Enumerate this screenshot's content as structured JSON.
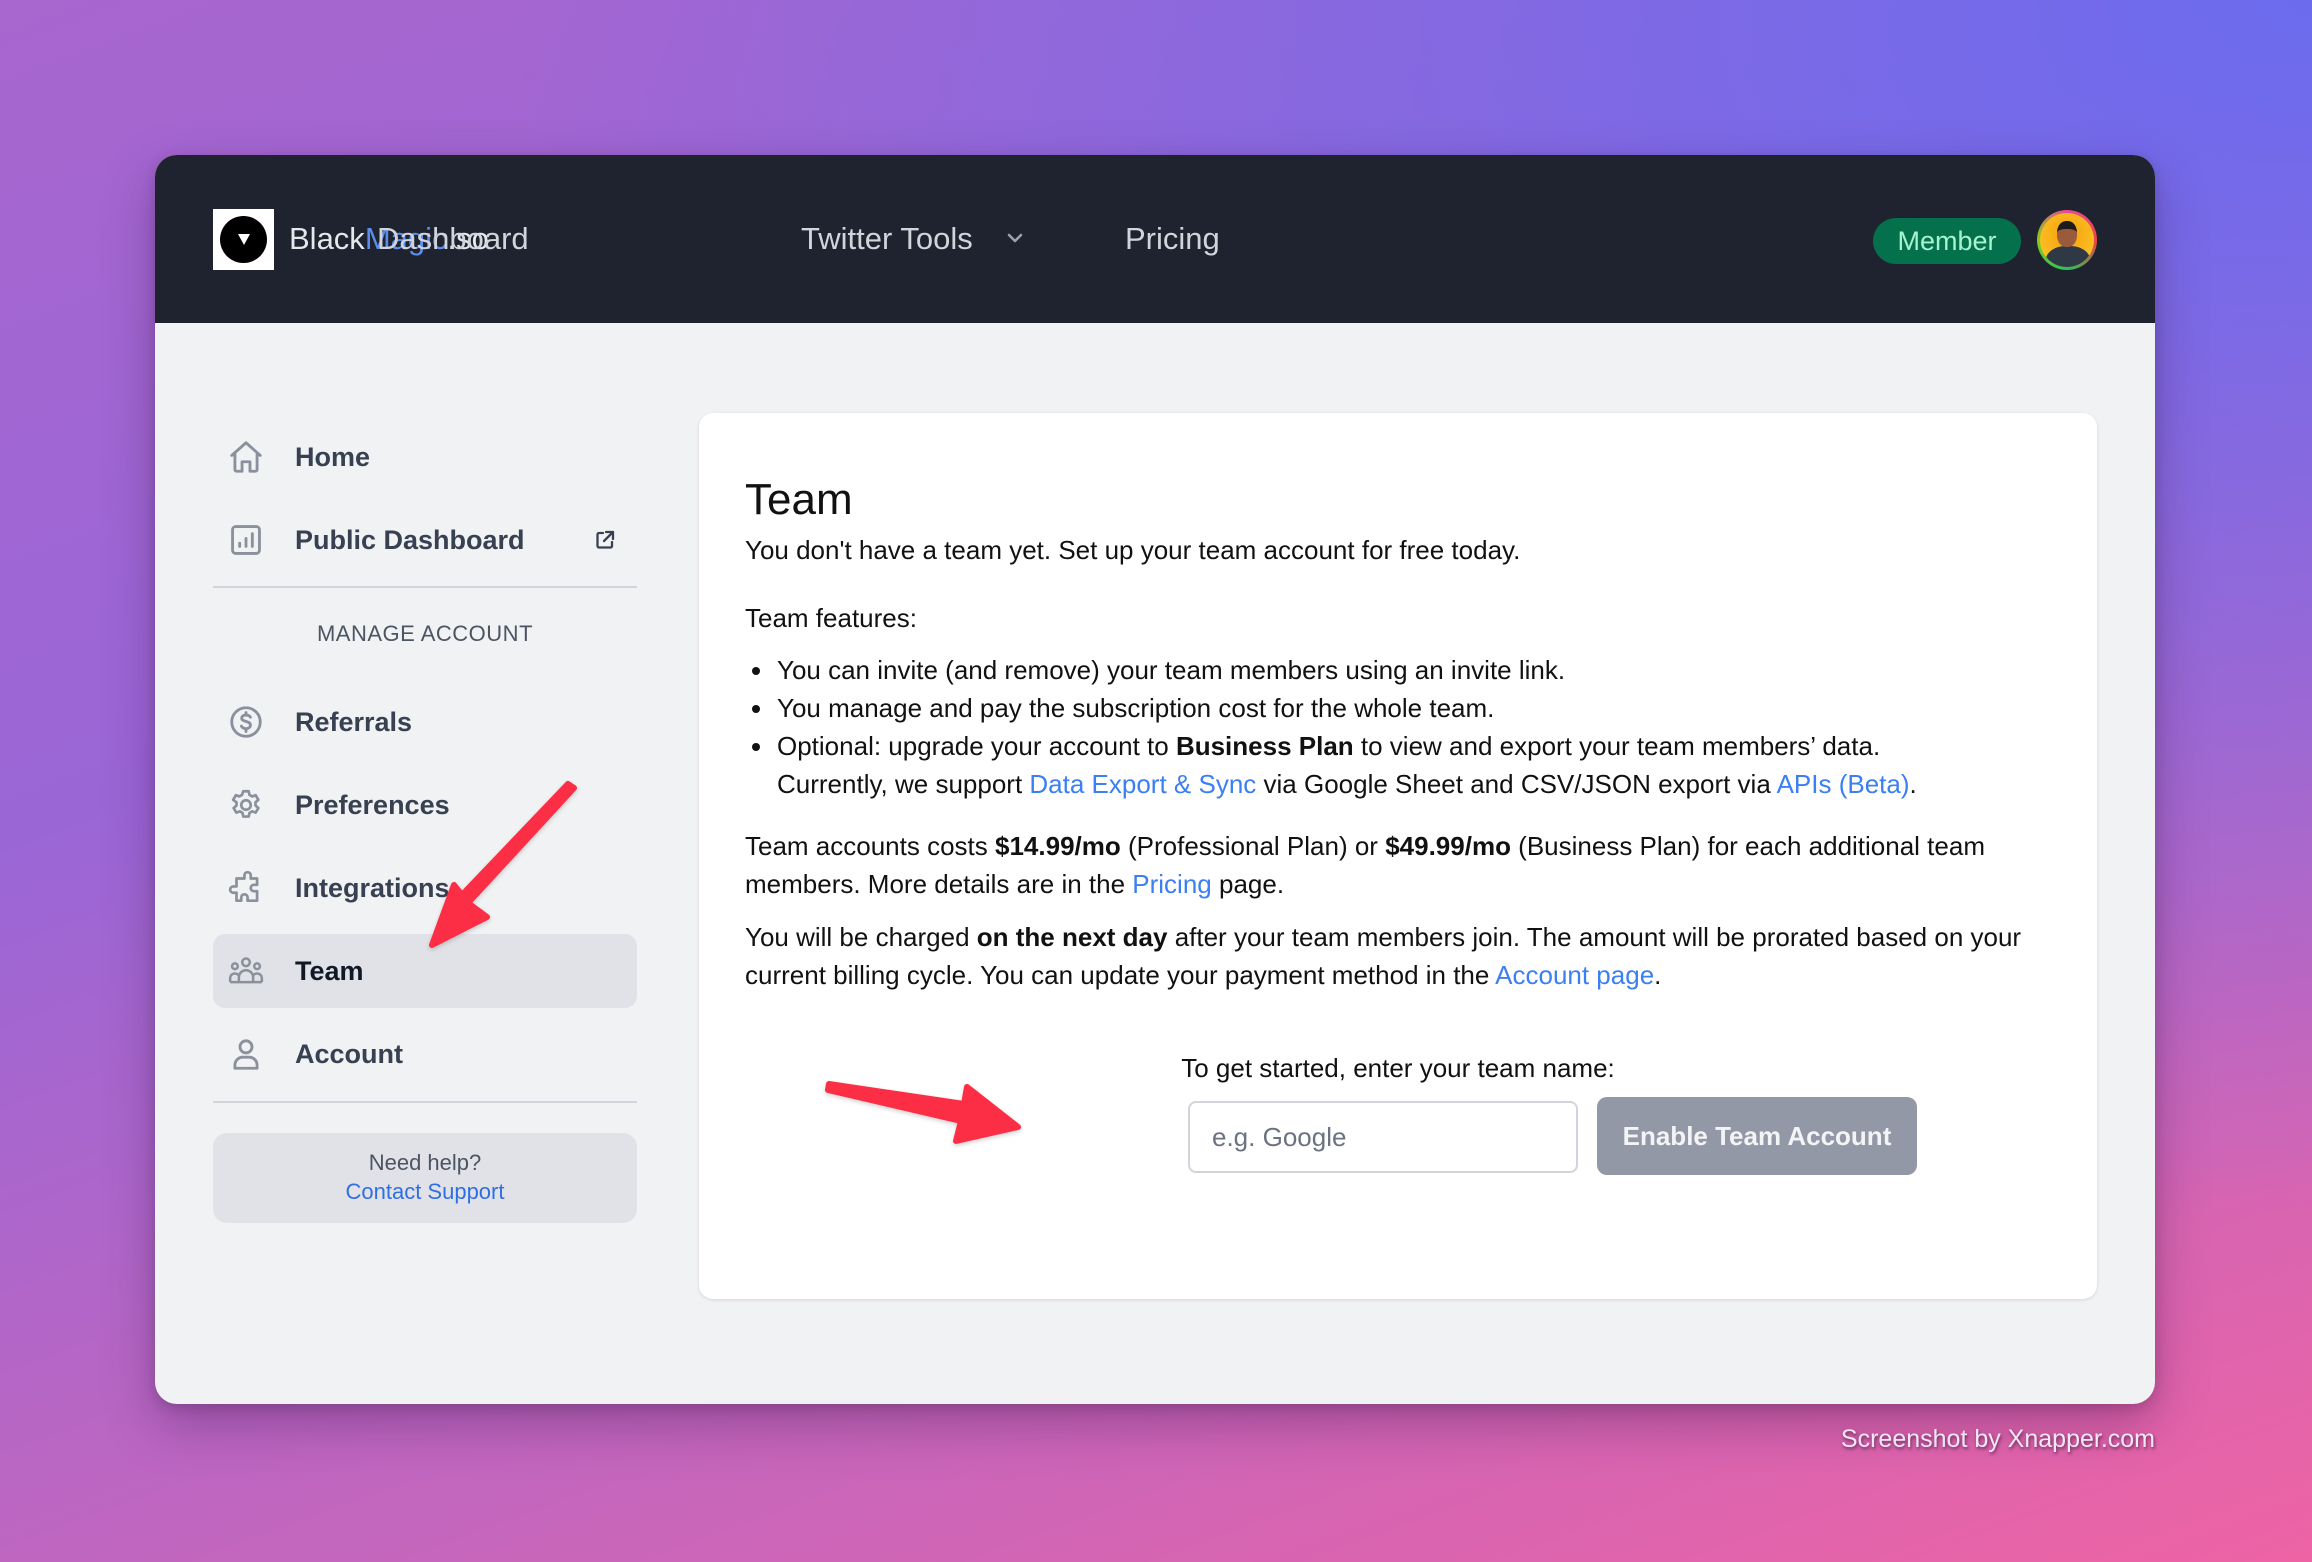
{
  "navbar": {
    "brand_prefix": "Black",
    "brand_accent": "Magic",
    "brand_suffix": ".so",
    "links": [
      {
        "label": "Dashboard"
      },
      {
        "label": "Twitter Tools",
        "has_dropdown": true
      },
      {
        "label": "Pricing"
      }
    ],
    "member_badge": "Member",
    "avatar_icon": "user-avatar"
  },
  "sidebar": {
    "top_items": [
      {
        "label": "Home",
        "icon": "home-icon"
      },
      {
        "label": "Public Dashboard",
        "icon": "chart-icon",
        "external": true
      }
    ],
    "section_label": "MANAGE ACCOUNT",
    "items": [
      {
        "label": "Referrals",
        "icon": "dollar-icon"
      },
      {
        "label": "Preferences",
        "icon": "gear-icon"
      },
      {
        "label": "Integrations",
        "icon": "puzzle-icon"
      },
      {
        "label": "Team",
        "icon": "users-icon",
        "active": true
      },
      {
        "label": "Account",
        "icon": "user-icon"
      }
    ],
    "help": {
      "question": "Need help?",
      "link": "Contact Support"
    }
  },
  "main": {
    "title": "Team",
    "intro": "You don't have a team yet. Set up your team account for free today.",
    "features_title": "Team features:",
    "features": {
      "f1": "You can invite (and remove) your team members using an invite link.",
      "f2": "You manage and pay the subscription cost for the whole team.",
      "f3_a": "Optional: upgrade your account to ",
      "f3_bold": "Business Plan",
      "f3_b": " to view and export your team members’ data.",
      "f3_c": "Currently, we support ",
      "f3_link1": "Data Export & Sync",
      "f3_d": " via Google Sheet and CSV/JSON export via ",
      "f3_link2": "APIs (Beta)",
      "f3_e": "."
    },
    "pricing": {
      "a": "Team accounts costs ",
      "price1": "$14.99/mo",
      "b": " (Professional Plan) or ",
      "price2": "$49.99/mo",
      "c": " (Business Plan) for each additional team members. More details are in the ",
      "link": "Pricing",
      "d": " page."
    },
    "charge": {
      "a": "You will be charged ",
      "bold": "on the next day",
      "b": " after your team members join. The amount will be prorated based on your current billing cycle. You can update your payment method in the ",
      "link": "Account page",
      "c": "."
    },
    "cta_label": "To get started, enter your team name:",
    "team_name_input": {
      "value": "",
      "placeholder": "e.g. Google"
    },
    "enable_button": "Enable Team Account"
  },
  "watermark": "Screenshot by Xnapper.com",
  "colors": {
    "navbar_bg": "#1f2330",
    "brand_accent": "#5b8def",
    "member_badge_bg": "#04704c",
    "member_badge_text": "#a7f3d0",
    "link": "#3b7ff2",
    "button_disabled": "#9398a6",
    "annotation_arrow": "#fb2e44"
  }
}
